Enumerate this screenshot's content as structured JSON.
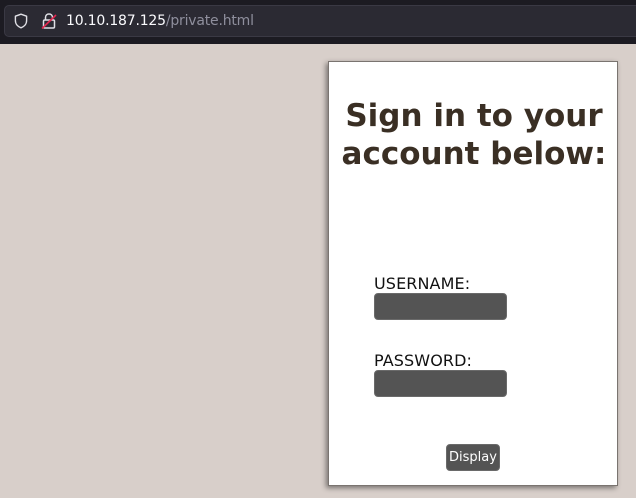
{
  "browser": {
    "url_host": "10.10.187.125",
    "url_path": "/private.html",
    "icons": {
      "tracking": "shield-icon",
      "security": "insecure-lock-icon"
    },
    "colors": {
      "chrome_bg": "#1c1b22",
      "urlbar_bg": "#2b2a33",
      "host_text": "#fbfbfe",
      "path_text": "#8f8f9d",
      "insecure_accent": "#e22850"
    }
  },
  "page": {
    "background": "#d8cfca"
  },
  "login": {
    "title": "Sign in to your account below:",
    "title_color": "#3a2f24",
    "username_label": "USERNAME:",
    "username_value": "",
    "password_label": "PASSWORD:",
    "password_value": "",
    "display_button": "Display",
    "input_bg": "#545454"
  }
}
